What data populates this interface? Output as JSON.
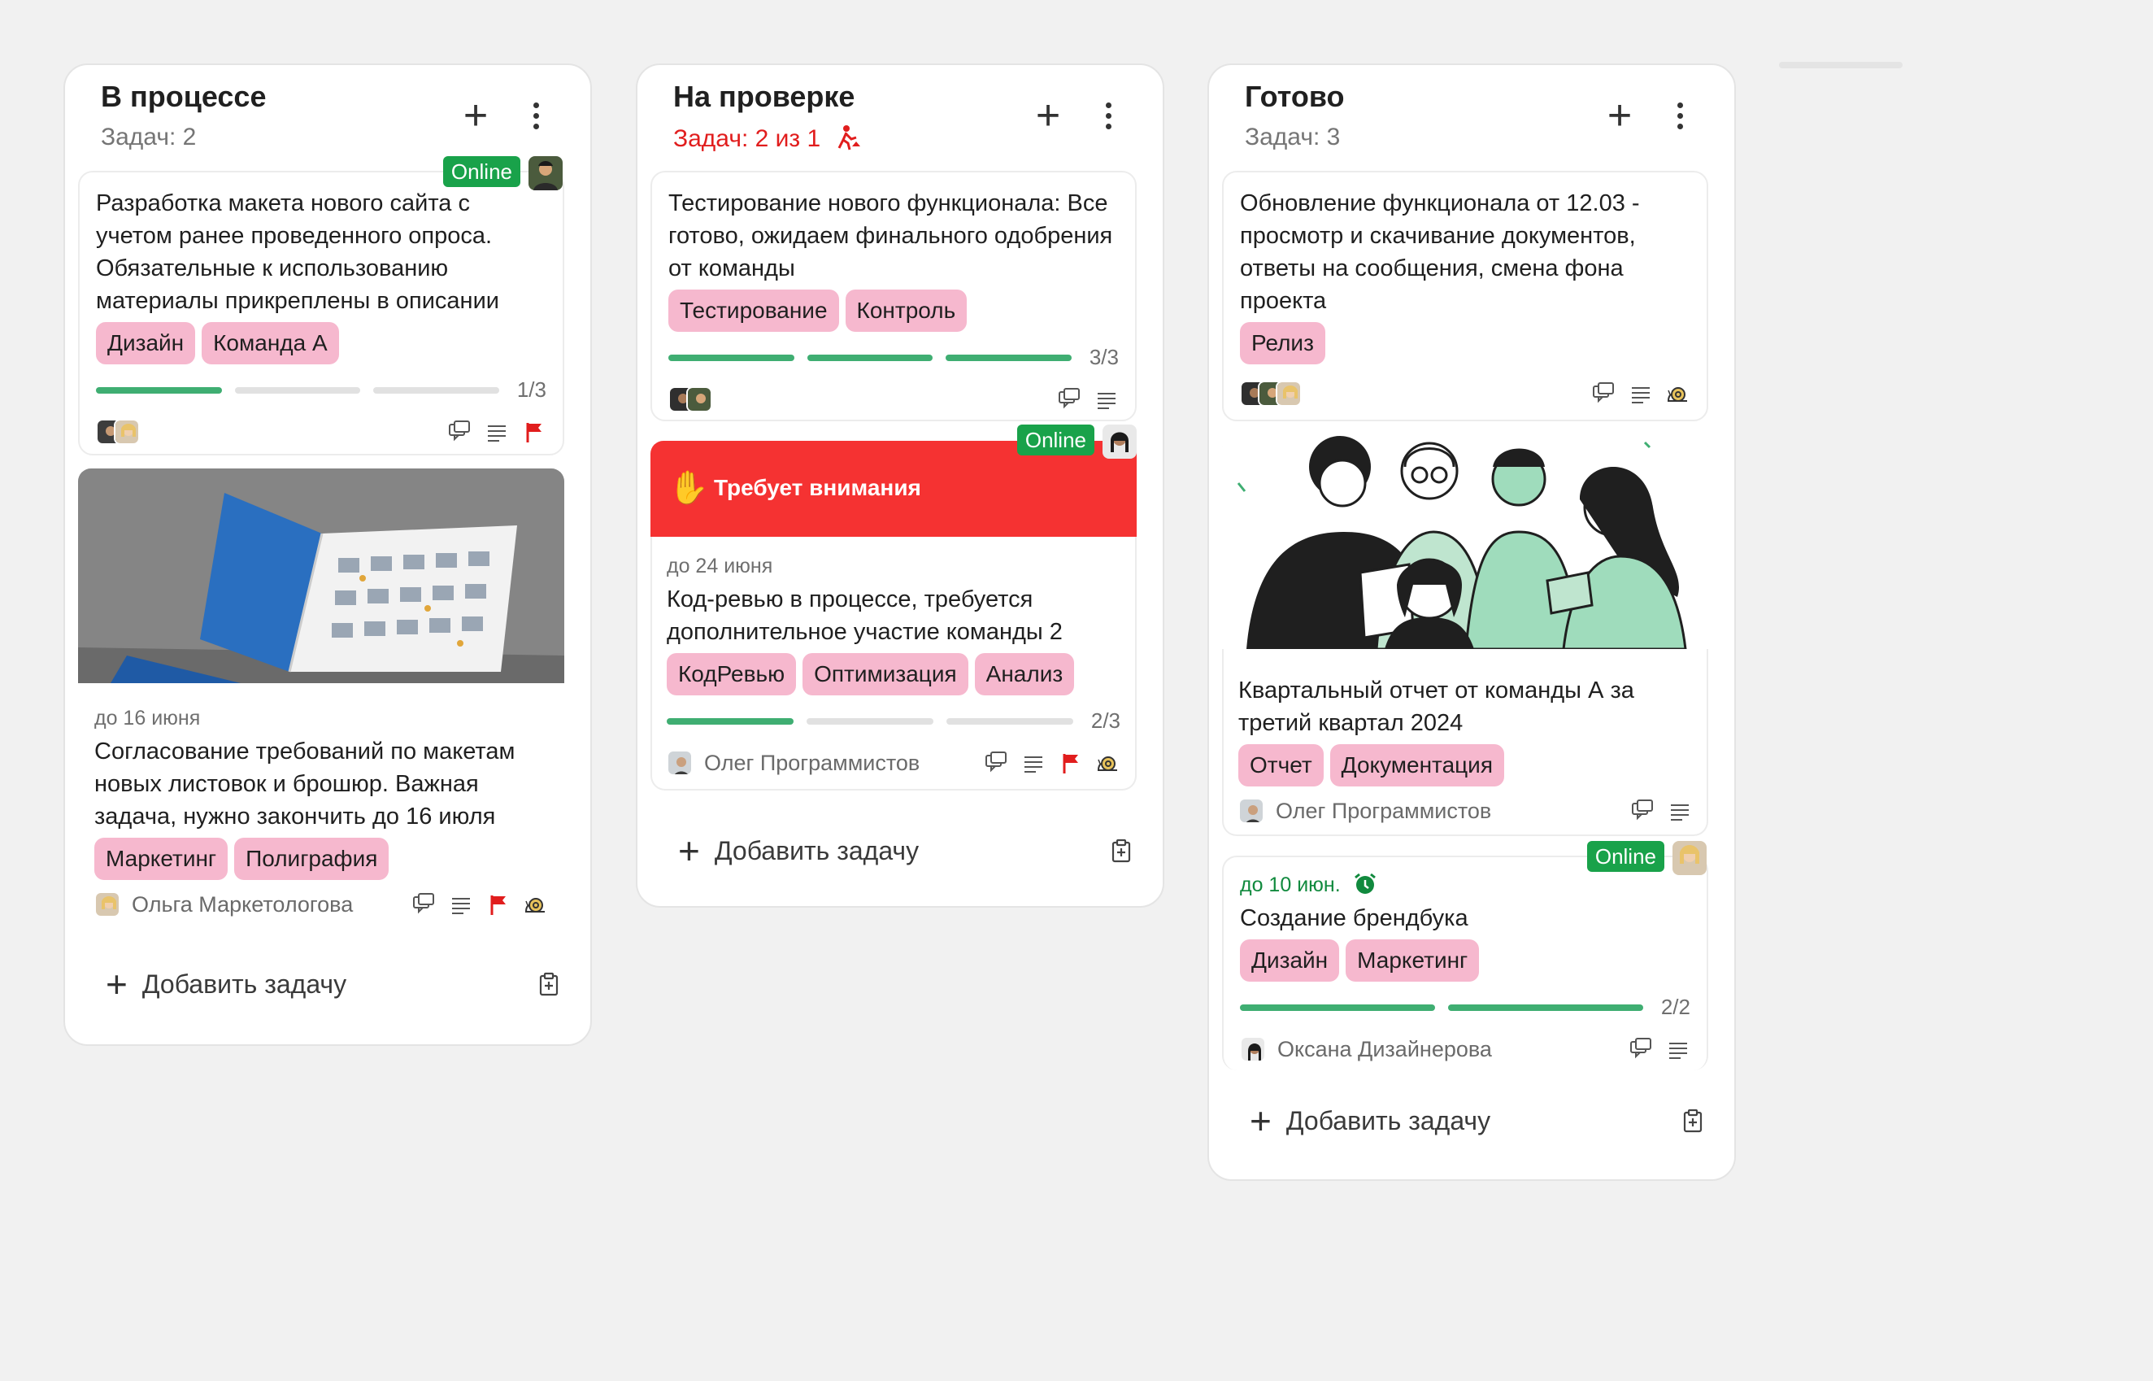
{
  "columns": [
    {
      "title": "В процессе",
      "count": "Задач: 2",
      "add_task": "Добавить задачу",
      "cards": [
        {
          "online": "Online",
          "title": "Разработка макета нового сайта с учетом ранее проведенного опроса. Обязательные к использованию материалы прикреплены в описании",
          "tags": [
            "Дизайн",
            "Команда А"
          ],
          "progress_label": "1/3",
          "progress_done": 1,
          "progress_total": 3
        },
        {
          "due": "до 16 июня",
          "title": "Согласование требований по макетам новых листовок и брошюр. Важная задача, нужно закончить до 16 июля",
          "tags": [
            "Маркетинг",
            "Полиграфия"
          ],
          "assignee": "Ольга Маркетологова"
        }
      ]
    },
    {
      "title": "На проверке",
      "count": "Задач: 2 из 1",
      "add_task": "Добавить задачу",
      "cards": [
        {
          "title": "Тестирование нового функционала: Все готово, ожидаем финального одобрения от команды",
          "tags": [
            "Тестирование",
            "Контроль"
          ],
          "progress_label": "3/3",
          "progress_done": 3,
          "progress_total": 3
        },
        {
          "online": "Online",
          "attention": "Требует внимания",
          "due": "до 24 июня",
          "title": "Код-ревью в процессе, требуется дополнительное участие команды 2",
          "tags": [
            "КодРевью",
            "Оптимизация",
            "Анализ"
          ],
          "progress_label": "2/3",
          "progress_done": 1,
          "progress_total": 3,
          "assignee": "Олег Программистов"
        }
      ]
    },
    {
      "title": "Готово",
      "count": "Задач: 3",
      "add_task": "Добавить задачу",
      "cards": [
        {
          "title": "Обновление функционала от 12.03 - просмотр и скачивание документов, ответы на сообщения, смена фона проекта",
          "tags": [
            "Релиз"
          ]
        },
        {
          "title": "Квартальный отчет от команды А за третий квартал 2024",
          "tags": [
            "Отчет",
            "Документация"
          ],
          "assignee": "Олег Программистов"
        },
        {
          "online": "Online",
          "due": "до 10 июн.",
          "title": "Создание брендбука",
          "tags": [
            "Дизайн",
            "Маркетинг"
          ],
          "progress_label": "2/2",
          "progress_done": 2,
          "progress_total": 2,
          "assignee": "Оксана Дизайнерова"
        }
      ]
    }
  ],
  "colors": {
    "accent_green": "#3fae72",
    "online_green": "#19a24a",
    "alert_red": "#f53232",
    "tag_pink": "#f6b8ce"
  }
}
